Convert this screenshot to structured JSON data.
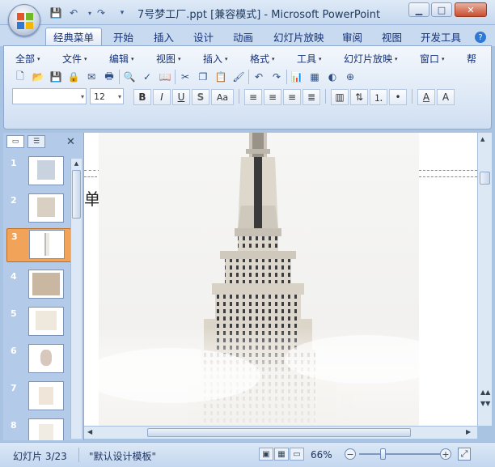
{
  "window": {
    "title": "7号梦工厂.ppt [兼容模式] - Microsoft PowerPoint",
    "minimize": "▁",
    "maximize": "□",
    "close": "✕"
  },
  "quick_access": [
    {
      "icon": "save-icon",
      "glyph": "💾"
    },
    {
      "icon": "undo-icon",
      "glyph": "↶"
    },
    {
      "icon": "redo-icon",
      "glyph": "↷"
    },
    {
      "icon": "customize-icon",
      "glyph": "▾"
    }
  ],
  "ribbon_tabs": [
    "经典菜单",
    "开始",
    "插入",
    "设计",
    "动画",
    "幻灯片放映",
    "审阅",
    "视图",
    "开发工具"
  ],
  "active_tab": "经典菜单",
  "menus": [
    "全部",
    "文件",
    "编辑",
    "视图",
    "插入",
    "格式",
    "工具",
    "幻灯片放映",
    "窗口",
    "帮"
  ],
  "toolbar_icons": [
    {
      "name": "new-icon",
      "glyph": "🗋"
    },
    {
      "name": "open-icon",
      "glyph": "📂"
    },
    {
      "name": "save-icon",
      "glyph": "💾"
    },
    {
      "name": "permission-icon",
      "glyph": "🔒"
    },
    {
      "name": "email-icon",
      "glyph": "✉"
    },
    {
      "name": "print-icon",
      "glyph": "🖶"
    },
    {
      "name": "print-preview-icon",
      "glyph": "🔍"
    },
    {
      "name": "spelling-icon",
      "glyph": "✓"
    },
    {
      "name": "research-icon",
      "glyph": "📖"
    },
    {
      "name": "cut-icon",
      "glyph": "✂"
    },
    {
      "name": "copy-icon",
      "glyph": "❐"
    },
    {
      "name": "paste-icon",
      "glyph": "📋"
    },
    {
      "name": "format-painter-icon",
      "glyph": "🖌"
    },
    {
      "name": "undo-icon",
      "glyph": "↶"
    },
    {
      "name": "redo-icon",
      "glyph": "↷"
    },
    {
      "name": "insert-chart-icon",
      "glyph": "📊"
    },
    {
      "name": "insert-table-icon",
      "glyph": "▦"
    },
    {
      "name": "color-grayscale-icon",
      "glyph": "◐"
    },
    {
      "name": "zoom-icon",
      "glyph": "⊕"
    }
  ],
  "font": {
    "name_value": "",
    "size_value": "12"
  },
  "format_buttons": [
    {
      "name": "bold-button",
      "label": "B"
    },
    {
      "name": "italic-button",
      "label": "I"
    },
    {
      "name": "underline-button",
      "label": "U"
    },
    {
      "name": "shadow-button",
      "label": "S"
    },
    {
      "name": "change-case-button",
      "label": "Aa"
    }
  ],
  "slides_panel": {
    "tab_slides_glyph": "▭",
    "tab_outline_glyph": "☰",
    "close_glyph": "✕",
    "slides": [
      {
        "num": "1",
        "color": "#c9d3df"
      },
      {
        "num": "2",
        "color": "#d9cfc2"
      },
      {
        "num": "3",
        "color": "#ece8e2"
      },
      {
        "num": "4",
        "color": "#c9b7a1"
      },
      {
        "num": "5",
        "color": "#efe8dc"
      },
      {
        "num": "6",
        "color": "#d7c7bc"
      },
      {
        "num": "7",
        "color": "#efe5d8"
      },
      {
        "num": "8",
        "color": "#f0ebe3"
      }
    ],
    "selected": 3
  },
  "slide": {
    "partial_text": "单"
  },
  "status": {
    "slide_info": "幻灯片 3/23",
    "template": "\"默认设计模板\"",
    "zoom": "66%",
    "zoom_out": "−",
    "zoom_in": "+",
    "fit_glyph": "⤢"
  },
  "colors": {
    "accent": "#f2a35a",
    "panel": "#b3cbe9"
  }
}
